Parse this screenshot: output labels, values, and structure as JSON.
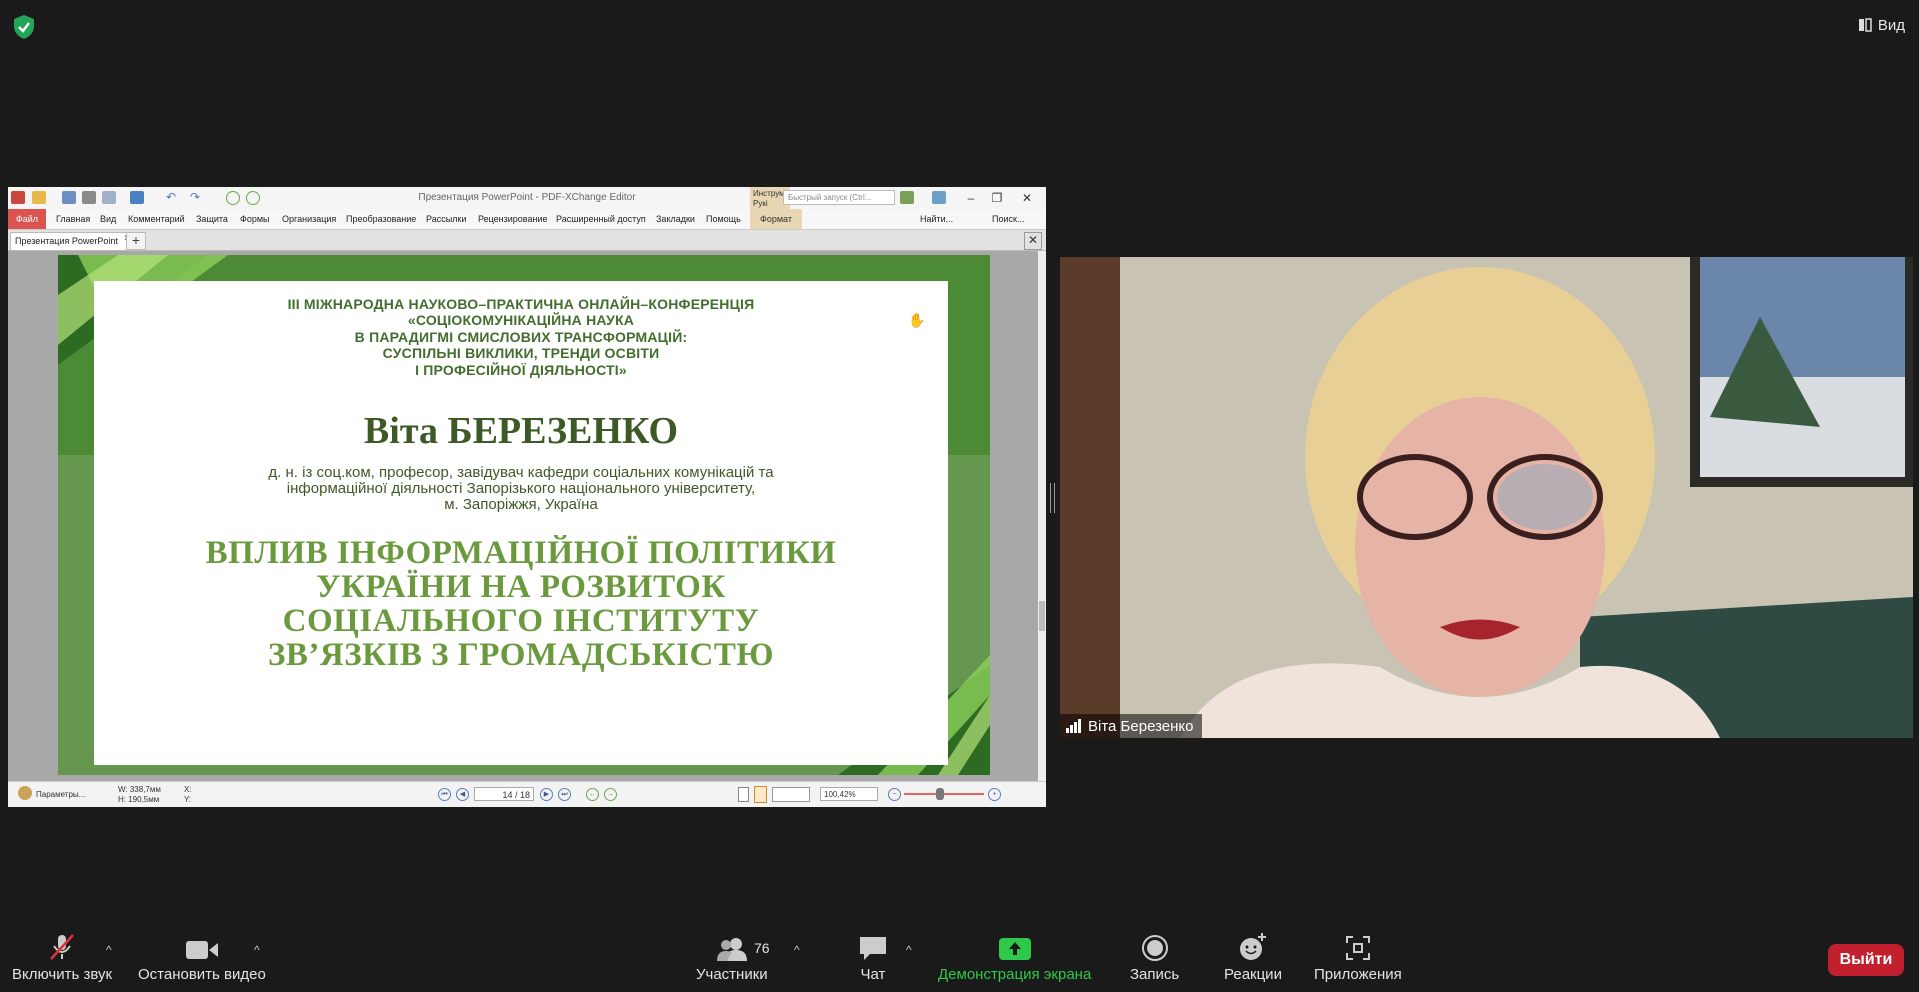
{
  "top": {
    "view_label": "Вид"
  },
  "pdf_app": {
    "window_title": "Презентация PowerPoint - PDF-XChange Editor",
    "tools_tab": "Инструм Рукі",
    "quick_search_placeholder": "Быстрый запуск (Ctrl...",
    "menu": {
      "file": "Файл",
      "items": [
        "Главная",
        "Вид",
        "Комментарий",
        "Защита",
        "Формы",
        "Организация",
        "Преобразование",
        "Рассылки",
        "Рецензирование",
        "Расширенный доступ",
        "Закладки",
        "Помощь"
      ],
      "format": "Формат",
      "find": "Найти...",
      "search": "Поиск..."
    },
    "doc_tab": "Презентация PowerPoint",
    "status": {
      "params": "Параметры...",
      "w": "W: 338,7мм",
      "h": "H: 190,5мм",
      "x": "X:",
      "y": "Y:",
      "page": "14",
      "page_total": "18",
      "zoom": "100,42%"
    }
  },
  "slide": {
    "conference_lines": [
      "ІІІ МІЖНАРОДНА НАУКОВО–ПРАКТИЧНА ОНЛАЙН–КОНФЕРЕНЦІЯ",
      "«СОЦІОКОМУНІКАЦІЙНА НАУКА",
      "В ПАРАДИГМІ СМИСЛОВИХ ТРАНСФОРМАЦІЙ:",
      "СУСПІЛЬНІ ВИКЛИКИ, ТРЕНДИ ОСВІТИ",
      "І ПРОФЕСІЙНОЇ ДІЯЛЬНОСТІ»"
    ],
    "speaker_name": "Віта БЕРЕЗЕНКО",
    "speaker_info_lines": [
      "д. н. із соц.ком, професор, завідувач  кафедри соціальних комунікацій та",
      "інформаційної діяльності Запорізького національного університету,",
      "м. Запоріжжя, Україна"
    ],
    "talk_title_lines": [
      "ВПЛИВ ІНФОРМАЦІЙНОЇ ПОЛІТИКИ",
      "УКРАЇНИ НА РОЗВИТОК",
      "СОЦІАЛЬНОГО ІНСТИТУТУ",
      "ЗВ’ЯЗКІВ З ГРОМАДСЬКІСТЮ"
    ]
  },
  "participant": {
    "name": "Віта Березенко"
  },
  "toolbar": {
    "mute": "Включить звук",
    "video": "Остановить видео",
    "participants": "Участники",
    "participants_count": "76",
    "chat": "Чат",
    "share": "Демонстрация экрана",
    "record": "Запись",
    "reactions": "Реакции",
    "apps": "Приложения",
    "leave": "Выйти"
  },
  "colors": {
    "share_green": "#2ec84a",
    "leave_red": "#c2202e",
    "slide_green": "#3f7a2d"
  }
}
